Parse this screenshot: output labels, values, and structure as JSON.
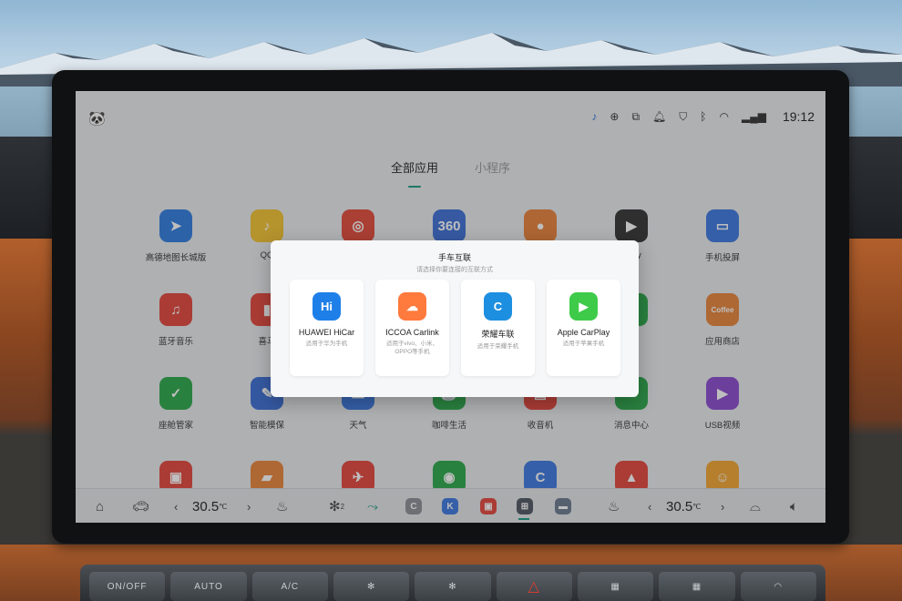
{
  "status_bar": {
    "time": "19:12",
    "icons": [
      "avatar-icon",
      "media-icon",
      "connect-icon",
      "phone-link-icon",
      "bell-icon",
      "shield-icon",
      "bluetooth-icon",
      "wifi-icon",
      "signal-icon"
    ]
  },
  "tabs": [
    {
      "label": "全部应用",
      "active": true
    },
    {
      "label": "小程序",
      "active": false
    }
  ],
  "apps": [
    {
      "label": "高德地图长城版",
      "color": "#2f7be0",
      "glyph": "➤"
    },
    {
      "label": "QQ",
      "color": "#f2c230",
      "glyph": "♪"
    },
    {
      "label": "",
      "color": "#e24a3a",
      "glyph": "◎"
    },
    {
      "label": "",
      "color": "#3d6fd6",
      "glyph": "360"
    },
    {
      "label": "",
      "color": "#e8823a",
      "glyph": "●"
    },
    {
      "label": "rPlay",
      "color": "#333333",
      "glyph": "▶"
    },
    {
      "label": "手机投屏",
      "color": "#3b78e0",
      "glyph": "▭"
    },
    {
      "label": "蓝牙音乐",
      "color": "#e2453c",
      "glyph": "♫"
    },
    {
      "label": "喜马",
      "color": "#e2453c",
      "glyph": "▮"
    },
    {
      "label": "",
      "color": "#ffffff",
      "glyph": ""
    },
    {
      "label": "",
      "color": "#ffffff",
      "glyph": ""
    },
    {
      "label": "",
      "color": "#ffffff",
      "glyph": ""
    },
    {
      "label": "",
      "color": "#2aa84a",
      "glyph": ""
    },
    {
      "label": "应用商店",
      "color": "#e8843a",
      "glyph": "Coffee"
    },
    {
      "label": "座舱管家",
      "color": "#2aa84a",
      "glyph": "✓"
    },
    {
      "label": "智能模保",
      "color": "#3b6fd6",
      "glyph": "✎"
    },
    {
      "label": "天气",
      "color": "#3b78e0",
      "glyph": "☁"
    },
    {
      "label": "咖啡生活",
      "color": "#2aa84a",
      "glyph": "☕"
    },
    {
      "label": "收音机",
      "color": "#e2453c",
      "glyph": "▤"
    },
    {
      "label": "消息中心",
      "color": "#2aa84a",
      "glyph": "✉"
    },
    {
      "label": "USB视频",
      "color": "#8b4ad0",
      "glyph": "▶"
    },
    {
      "label": "",
      "color": "#e2453c",
      "glyph": "▣"
    },
    {
      "label": "",
      "color": "#e8843a",
      "glyph": "▰"
    },
    {
      "label": "",
      "color": "#e2453c",
      "glyph": "✈"
    },
    {
      "label": "",
      "color": "#2aa84a",
      "glyph": "◉"
    },
    {
      "label": "",
      "color": "#3b78e0",
      "glyph": "C"
    },
    {
      "label": "",
      "color": "#e2453c",
      "glyph": "▲"
    },
    {
      "label": "",
      "color": "#f2a530",
      "glyph": "☺"
    }
  ],
  "dialog": {
    "title": "手车互联",
    "subtitle": "请选择你要连接的互联方式",
    "options": [
      {
        "name": "HUAWEI HiCar",
        "desc": "适用于华为手机",
        "color": "#1e7fe8",
        "glyph": "Hi"
      },
      {
        "name": "ICCOA Carlink",
        "desc": "适用于vivo、小米、OPPO等手机",
        "color": "#ff7a3d",
        "glyph": "☁"
      },
      {
        "name": "荣耀车联",
        "desc": "适用于荣耀手机",
        "color": "#1d8fe0",
        "glyph": "C"
      },
      {
        "name": "Apple CarPlay",
        "desc": "适用于苹果手机",
        "color": "#3ecb4a",
        "glyph": "▶"
      }
    ]
  },
  "dock": {
    "left_temp": "30.5",
    "right_temp": "30.5",
    "temp_unit": "℃",
    "fan_level": "2"
  },
  "console": {
    "buttons": [
      "ON/OFF",
      "AUTO",
      "A/C",
      "✻",
      "✻",
      "△",
      "▦",
      "▦",
      "◠"
    ]
  }
}
